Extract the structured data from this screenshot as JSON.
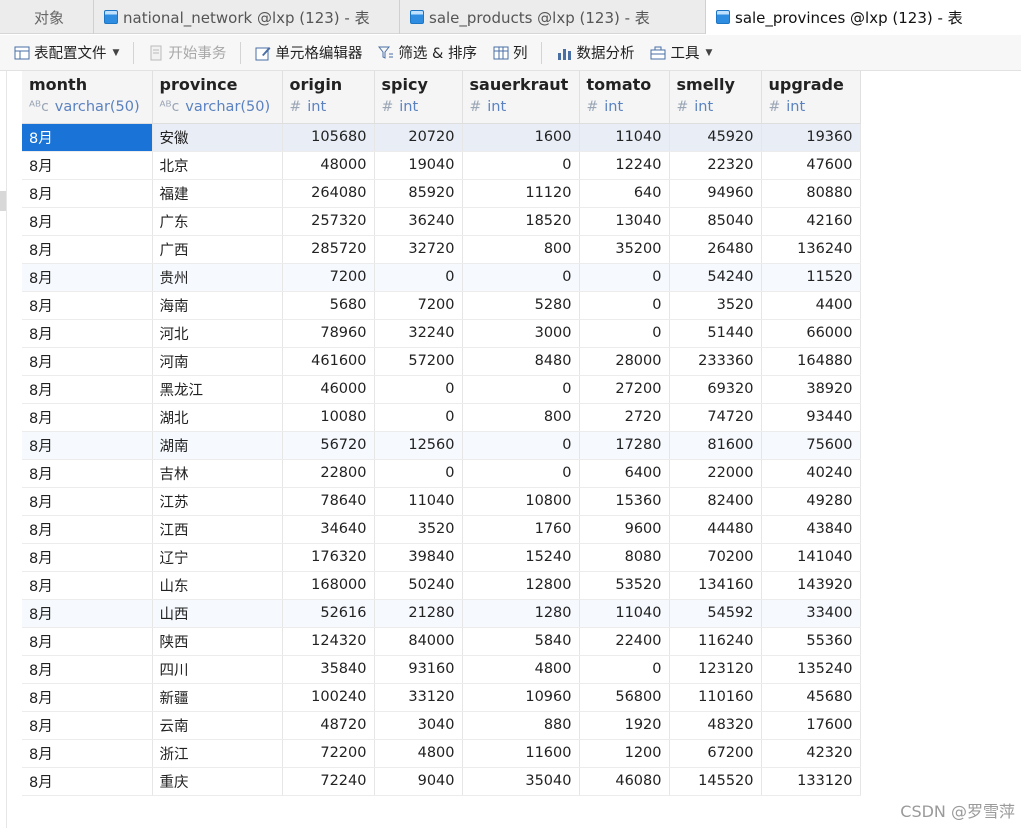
{
  "tabs": [
    {
      "label": "对象"
    },
    {
      "label": "national_network @lxp (123) - 表"
    },
    {
      "label": "sale_products @lxp (123) - 表"
    },
    {
      "label": "sale_provinces @lxp (123) - 表"
    }
  ],
  "toolbar": {
    "table_config": "表配置文件",
    "begin_transaction": "开始事务",
    "cell_editor": "单元格编辑器",
    "filter_sort": "筛选 & 排序",
    "columns": "列",
    "data_analysis": "数据分析",
    "tools": "工具"
  },
  "grid": {
    "columns": [
      {
        "name": "month",
        "type": "varchar(50)",
        "type_icon": "text-type-icon"
      },
      {
        "name": "province",
        "type": "varchar(50)",
        "type_icon": "text-type-icon"
      },
      {
        "name": "origin",
        "type": "int",
        "type_icon": "number-type-icon"
      },
      {
        "name": "spicy",
        "type": "int",
        "type_icon": "number-type-icon"
      },
      {
        "name": "sauerkraut",
        "type": "int",
        "type_icon": "number-type-icon"
      },
      {
        "name": "tomato",
        "type": "int",
        "type_icon": "number-type-icon"
      },
      {
        "name": "smelly",
        "type": "int",
        "type_icon": "number-type-icon"
      },
      {
        "name": "upgrade",
        "type": "int",
        "type_icon": "number-type-icon"
      }
    ],
    "rows": [
      [
        "8月",
        "安徽",
        "105680",
        "20720",
        "1600",
        "11040",
        "45920",
        "19360"
      ],
      [
        "8月",
        "北京",
        "48000",
        "19040",
        "0",
        "12240",
        "22320",
        "47600"
      ],
      [
        "8月",
        "福建",
        "264080",
        "85920",
        "11120",
        "640",
        "94960",
        "80880"
      ],
      [
        "8月",
        "广东",
        "257320",
        "36240",
        "18520",
        "13040",
        "85040",
        "42160"
      ],
      [
        "8月",
        "广西",
        "285720",
        "32720",
        "800",
        "35200",
        "26480",
        "136240"
      ],
      [
        "8月",
        "贵州",
        "7200",
        "0",
        "0",
        "0",
        "54240",
        "11520"
      ],
      [
        "8月",
        "海南",
        "5680",
        "7200",
        "5280",
        "0",
        "3520",
        "4400"
      ],
      [
        "8月",
        "河北",
        "78960",
        "32240",
        "3000",
        "0",
        "51440",
        "66000"
      ],
      [
        "8月",
        "河南",
        "461600",
        "57200",
        "8480",
        "28000",
        "233360",
        "164880"
      ],
      [
        "8月",
        "黑龙江",
        "46000",
        "0",
        "0",
        "27200",
        "69320",
        "38920"
      ],
      [
        "8月",
        "湖北",
        "10080",
        "0",
        "800",
        "2720",
        "74720",
        "93440"
      ],
      [
        "8月",
        "湖南",
        "56720",
        "12560",
        "0",
        "17280",
        "81600",
        "75600"
      ],
      [
        "8月",
        "吉林",
        "22800",
        "0",
        "0",
        "6400",
        "22000",
        "40240"
      ],
      [
        "8月",
        "江苏",
        "78640",
        "11040",
        "10800",
        "15360",
        "82400",
        "49280"
      ],
      [
        "8月",
        "江西",
        "34640",
        "3520",
        "1760",
        "9600",
        "44480",
        "43840"
      ],
      [
        "8月",
        "辽宁",
        "176320",
        "39840",
        "15240",
        "8080",
        "70200",
        "141040"
      ],
      [
        "8月",
        "山东",
        "168000",
        "50240",
        "12800",
        "53520",
        "134160",
        "143920"
      ],
      [
        "8月",
        "山西",
        "52616",
        "21280",
        "1280",
        "11040",
        "54592",
        "33400"
      ],
      [
        "8月",
        "陕西",
        "124320",
        "84000",
        "5840",
        "22400",
        "116240",
        "55360"
      ],
      [
        "8月",
        "四川",
        "35840",
        "93160",
        "4800",
        "0",
        "123120",
        "135240"
      ],
      [
        "8月",
        "新疆",
        "100240",
        "33120",
        "10960",
        "56800",
        "110160",
        "45680"
      ],
      [
        "8月",
        "云南",
        "48720",
        "3040",
        "880",
        "1920",
        "48320",
        "17600"
      ],
      [
        "8月",
        "浙江",
        "72200",
        "4800",
        "11600",
        "1200",
        "67200",
        "42320"
      ],
      [
        "8月",
        "重庆",
        "72240",
        "9040",
        "35040",
        "46080",
        "145520",
        "133120"
      ]
    ],
    "selected_row": 0,
    "selected_col": 0
  },
  "watermark": "CSDN @罗雪萍",
  "colors": {
    "selection": "#1a73d6",
    "type_text": "#5b82c0"
  }
}
